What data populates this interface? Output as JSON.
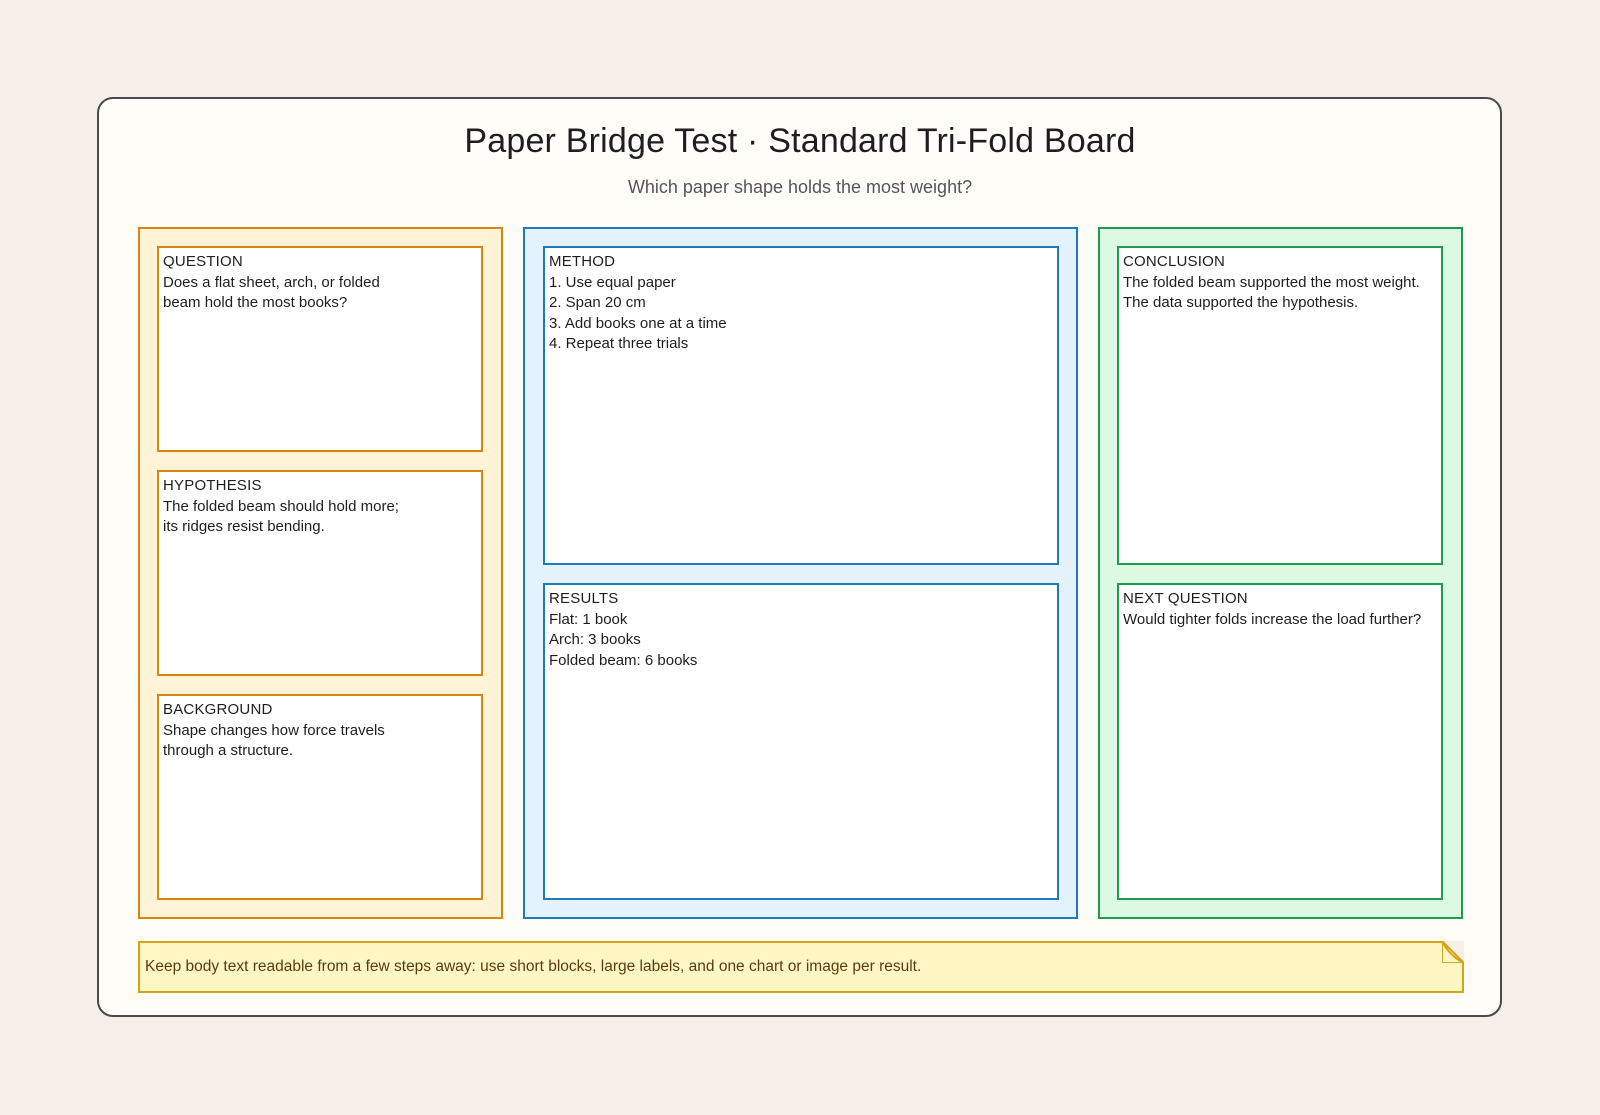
{
  "board": {
    "title": "Paper Bridge Test · Standard Tri-Fold Board",
    "subtitle": "Which paper shape holds the most weight?"
  },
  "panels": {
    "left": {
      "color": "#d4860e",
      "cards": [
        {
          "label": "QUESTION",
          "lines": [
            "Does a flat sheet, arch, or folded",
            "beam hold the most books?"
          ]
        },
        {
          "label": "HYPOTHESIS",
          "lines": [
            "The folded beam should hold more;",
            "its ridges resist bending."
          ]
        },
        {
          "label": "BACKGROUND",
          "lines": [
            "Shape changes how force travels",
            "through a structure."
          ]
        }
      ]
    },
    "center": {
      "color": "#1e7ab8",
      "cards": [
        {
          "label": "METHOD",
          "lines": [
            "1. Use equal paper",
            "2. Span 20 cm",
            "3. Add books one at a time",
            "4. Repeat three trials"
          ]
        },
        {
          "label": "RESULTS",
          "lines": [
            "Flat: 1 book",
            "Arch: 3 books",
            "Folded beam: 6 books"
          ]
        }
      ]
    },
    "right": {
      "color": "#1f9a4e",
      "cards": [
        {
          "label": "CONCLUSION",
          "lines": [
            "The folded beam supported the most weight.",
            "The data supported the hypothesis."
          ]
        },
        {
          "label": "NEXT QUESTION",
          "lines": [
            "Would tighter folds increase the load further?"
          ]
        }
      ]
    }
  },
  "note": {
    "text": "Keep body text readable from a few steps away: use short blocks, large labels, and one chart or image per result.",
    "color": "#d4a417"
  }
}
